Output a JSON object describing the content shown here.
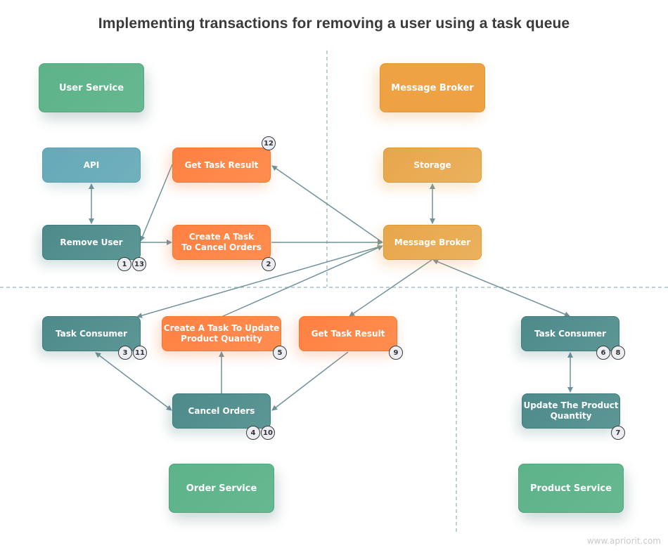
{
  "title": "Implementing transactions for removing a user using a task queue",
  "colors": {
    "service_green": "#5db38a",
    "api_blue": "#6aaab8",
    "teal": "#52908f",
    "orange": "#ff8647",
    "amber": "#e9aa52",
    "broker_orange": "#efa244",
    "connector": "#6f929a",
    "divider": "#a9bfc4"
  },
  "nodes": {
    "user_service": "User Service",
    "message_broker_service": "Message Broker",
    "api": "API",
    "get_task_result_top": "Get Task Result",
    "storage": "Storage",
    "remove_user": "Remove User",
    "create_task_cancel_orders": [
      "Create A Task",
      "To Cancel Orders"
    ],
    "message_broker": "Message Broker",
    "task_consumer_order": "Task Consumer",
    "create_task_update_qty": [
      "Create A Task To Update",
      "Product Quantity"
    ],
    "get_task_result_bottom": "Get Task Result",
    "task_consumer_product": "Task Consumer",
    "cancel_orders": "Cancel Orders",
    "update_product_quantity": [
      "Update The Product",
      "Quantity"
    ],
    "order_service": "Order Service",
    "product_service": "Product Service"
  },
  "steps": {
    "remove_user": [
      "1",
      "13"
    ],
    "create_task_cancel_orders": [
      "2"
    ],
    "get_task_result_top": [
      "12"
    ],
    "task_consumer_order": [
      "3",
      "11"
    ],
    "cancel_orders": [
      "4",
      "10"
    ],
    "create_task_update_qty": [
      "5"
    ],
    "task_consumer_product": [
      "6",
      "8"
    ],
    "update_product_quantity": [
      "7"
    ],
    "get_task_result_bottom": [
      "9"
    ]
  },
  "watermark": "www.apriorit.com"
}
